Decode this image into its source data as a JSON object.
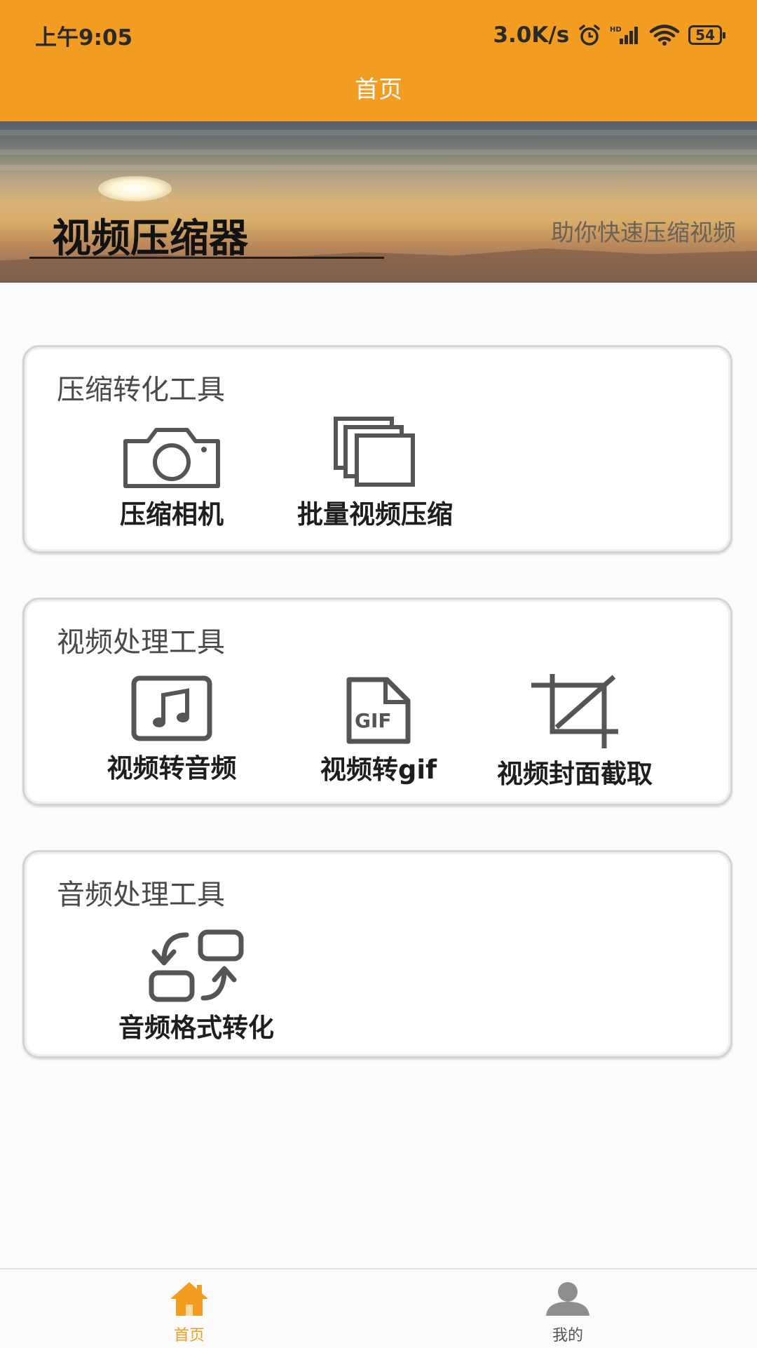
{
  "status_bar": {
    "time": "上午9:05",
    "network_speed": "3.0K/s",
    "battery": "54",
    "icons": [
      "alarm-icon",
      "hd-signal-icon",
      "wifi-icon",
      "battery-icon"
    ]
  },
  "header": {
    "title": "首页"
  },
  "banner": {
    "title": "视频压缩器",
    "subtitle": "助你快速压缩视频"
  },
  "sections": [
    {
      "title": "压缩转化工具",
      "tools": [
        {
          "label": "压缩相机",
          "icon": "camera-icon"
        },
        {
          "label": "批量视频压缩",
          "icon": "stacked-pages-icon"
        }
      ]
    },
    {
      "title": "视频处理工具",
      "tools": [
        {
          "label": "视频转音频",
          "icon": "music-note-icon"
        },
        {
          "label": "视频转gif",
          "icon": "gif-file-icon"
        },
        {
          "label": "视频封面截取",
          "icon": "crop-icon"
        }
      ]
    },
    {
      "title": "音频处理工具",
      "tools": [
        {
          "label": "音频格式转化",
          "icon": "swap-format-icon"
        }
      ]
    }
  ],
  "bottom_nav": {
    "items": [
      {
        "label": "首页",
        "icon": "home-icon",
        "active": true
      },
      {
        "label": "我的",
        "icon": "user-icon",
        "active": false
      }
    ]
  },
  "colors": {
    "accent": "#f39c22",
    "icon_gray": "#555555",
    "card_border": "#d4d4d4",
    "inactive_nav": "#555555"
  }
}
